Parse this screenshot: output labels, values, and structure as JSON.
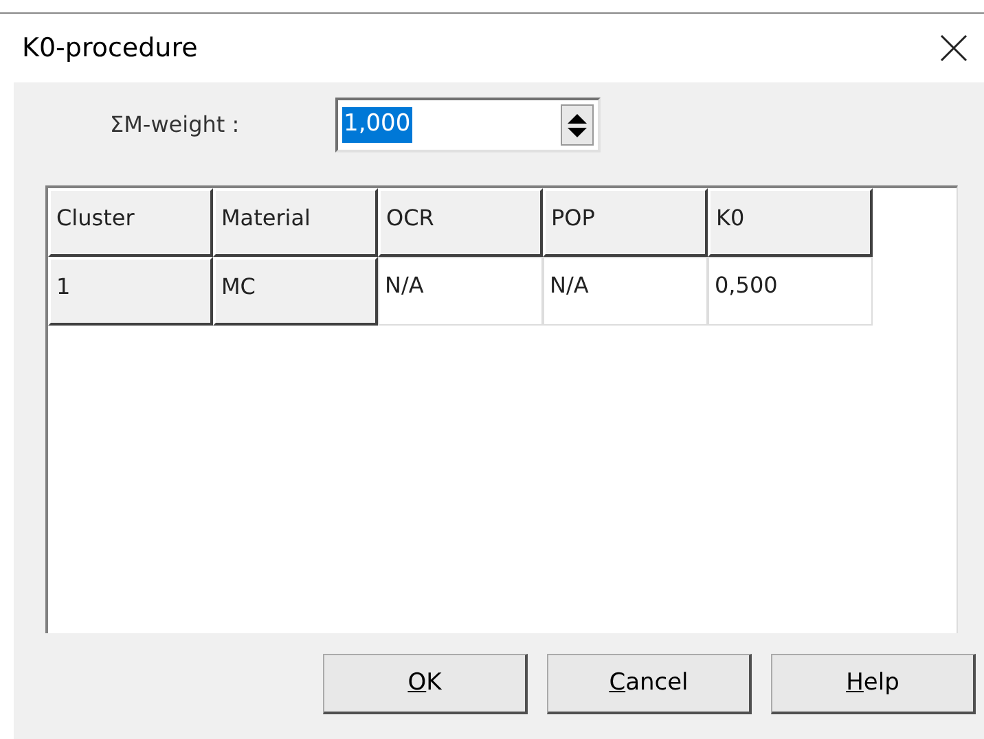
{
  "window": {
    "title": "K0-procedure"
  },
  "weight": {
    "label": "ΣM-weight :",
    "value": "1,000",
    "selected": true
  },
  "table": {
    "columns": [
      "Cluster",
      "Material",
      "OCR",
      "POP",
      "K0"
    ],
    "rows": [
      {
        "cells": [
          {
            "text": "1",
            "fixed": true
          },
          {
            "text": "MC",
            "fixed": true
          },
          {
            "text": "N/A",
            "fixed": false
          },
          {
            "text": "N/A",
            "fixed": false
          },
          {
            "text": "0,500",
            "fixed": false
          }
        ]
      }
    ]
  },
  "buttons": [
    {
      "hotkey": "O",
      "rest": "K"
    },
    {
      "hotkey": "C",
      "rest": "ancel"
    },
    {
      "hotkey": "H",
      "rest": "elp"
    }
  ]
}
